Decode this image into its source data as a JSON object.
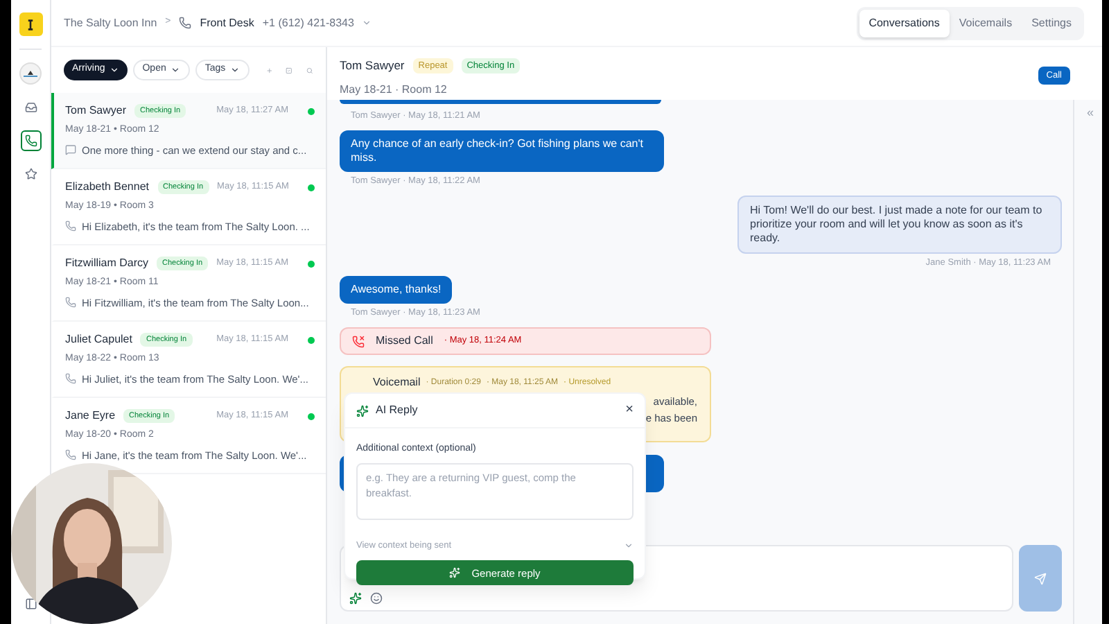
{
  "header": {
    "property": "The Salty Loon Inn",
    "separator": ">",
    "line": "Front Desk",
    "phone": "+1 (612) 421-8343"
  },
  "tabs": [
    {
      "label": "Conversations",
      "selected": true
    },
    {
      "label": "Voicemails",
      "selected": false
    },
    {
      "label": "Settings",
      "selected": false
    }
  ],
  "rail": [
    {
      "kind": "inbox",
      "selected": false
    },
    {
      "kind": "phone",
      "selected": true
    },
    {
      "kind": "star",
      "selected": false
    }
  ],
  "filters": [
    {
      "label": "Arriving",
      "selected": true
    },
    {
      "label": "Open",
      "selected": false
    },
    {
      "label": "Tags",
      "selected": false
    }
  ],
  "conversations": [
    {
      "name": "Tom Sawyer",
      "tag": "Checking In",
      "time": "May 18, 11:27 AM",
      "unread": true,
      "stay": "May 18-21 • Room 12",
      "preview": "One more thing - can we extend our stay and c...",
      "kind": "message",
      "selected": true
    },
    {
      "name": "Elizabeth Bennet",
      "tag": "Checking In",
      "time": "May 18, 11:15 AM",
      "unread": true,
      "stay": "May 18-19 • Room 3",
      "preview": "Hi Elizabeth, it's the team from The Salty Loon. ...",
      "kind": "call",
      "selected": false
    },
    {
      "name": "Fitzwilliam Darcy",
      "tag": "Checking In",
      "time": "May 18, 11:15 AM",
      "unread": true,
      "stay": "May 18-21 • Room 11",
      "preview": "Hi Fitzwilliam, it's the team from The Salty Loon...",
      "kind": "call",
      "selected": false
    },
    {
      "name": "Juliet Capulet",
      "tag": "Checking In",
      "time": "May 18, 11:15 AM",
      "unread": true,
      "stay": "May 18-22 • Room 13",
      "preview": "Hi Juliet, it's the team from The Salty Loon. We'...",
      "kind": "call",
      "selected": false
    },
    {
      "name": "Jane Eyre",
      "tag": "Checking In",
      "time": "May 18, 11:15 AM",
      "unread": true,
      "stay": "May 18-20 • Room 2",
      "preview": "Hi Jane, it's the team from The Salty Loon. We'...",
      "kind": "call",
      "selected": false
    }
  ],
  "chat": {
    "name": "Tom Sawyer",
    "tags": [
      {
        "label": "Repeat",
        "color": "#fdf6d8"
      },
      {
        "label": "Checking In",
        "color": "#e3f7e6"
      }
    ],
    "stay": "May 18-21 · Room 12",
    "call_button": "Call",
    "collapse": "«"
  },
  "messages": [
    {
      "kind": "meta",
      "outgoing": false,
      "text": "Tom Sawyer · May 18, 11:21 AM"
    },
    {
      "kind": "bubble",
      "outgoing": false,
      "text": "Any chance of an early check-in? Got fishing plans we can't miss."
    },
    {
      "kind": "meta",
      "outgoing": false,
      "text": "Tom Sawyer · May 18, 11:22 AM"
    },
    {
      "kind": "bubble",
      "outgoing": true,
      "text": "Hi Tom! We'll do our best. I just made a note for our team to prioritize your room and will let you know as soon as it's ready."
    },
    {
      "kind": "meta",
      "outgoing": true,
      "text": "Jane Smith · May 18, 11:23 AM"
    },
    {
      "kind": "bubble",
      "outgoing": false,
      "text": "Awesome, thanks!"
    },
    {
      "kind": "meta",
      "outgoing": false,
      "text": "Tom Sawyer · May 18, 11:23 AM"
    },
    {
      "kind": "missed",
      "label": "Missed Call",
      "time": "· May 18, 11:24 AM"
    },
    {
      "kind": "voicemail",
      "label": "Voicemail",
      "duration": "· Duration 0:29",
      "time": "· May 18, 11:25 AM",
      "status": "· Unresolved",
      "fragments": [
        "available,",
        "e has been"
      ]
    },
    {
      "kind": "hidden_bubble",
      "outgoing": false
    }
  ],
  "ai_reply": {
    "title": "AI Reply",
    "close": "×",
    "context_label": "Additional context (optional)",
    "placeholder": "e.g. They are a returning VIP guest, comp the breakfast.",
    "view_context": "View context being sent",
    "generate": "Generate reply"
  }
}
